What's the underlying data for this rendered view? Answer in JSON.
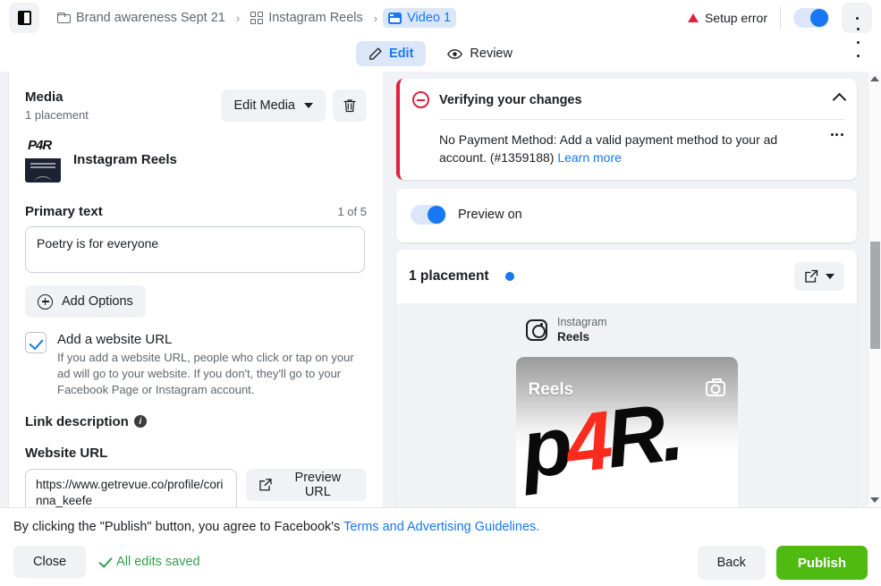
{
  "topbar": {
    "sidebar_toggle_icon": "panel-left-icon",
    "breadcrumb": [
      {
        "label": "Brand awareness Sept 21",
        "icon": "folder-icon",
        "active": false
      },
      {
        "label": "Instagram Reels",
        "icon": "grid-icon",
        "active": false
      },
      {
        "label": "Video 1",
        "icon": "video-card-icon",
        "active": true
      }
    ],
    "separator": "›",
    "setup_error_label": "Setup error",
    "warning_icon": "warning-triangle-icon",
    "toggle_on": true,
    "more_icon": "ellipsis-icon"
  },
  "tabs": [
    {
      "label": "Edit",
      "icon": "pencil-icon",
      "active": true
    },
    {
      "label": "Review",
      "icon": "eye-icon",
      "active": false
    }
  ],
  "left_panel": {
    "media": {
      "title": "Media",
      "subtitle": "1 placement",
      "edit_button": "Edit Media",
      "delete_icon": "trash-icon",
      "caret_icon": "chevron-down-icon",
      "item_name": "Instagram Reels",
      "thumbnail_logo": "P4R"
    },
    "primary_text": {
      "label": "Primary text",
      "counter": "1 of 5",
      "value": "Poetry is for everyone"
    },
    "add_options_button": "Add Options",
    "website_url_checkbox": {
      "checked": true,
      "label": "Add a website URL",
      "help": "If you add a website URL, people who click or tap on your ad will go to your website. If you don't, they'll go to your Facebook Page or Instagram account."
    },
    "link_description": {
      "label": "Link description",
      "info_icon": "info-icon"
    },
    "website_url": {
      "label": "Website URL",
      "value": "https://www.getrevue.co/profile/corinna_keefe",
      "preview_button": "Preview URL",
      "preview_icon": "external-link-icon"
    }
  },
  "right_panel": {
    "error_card": {
      "icon": "stop-circle-icon",
      "title": "Verifying your changes",
      "collapse_icon": "chevron-up-icon",
      "message": "No Payment Method: Add a valid payment method to your ad account. (#1359188)",
      "link_text": "Learn more",
      "more_icon": "ellipsis-icon",
      "accent_color": "#e41e3f"
    },
    "preview_toggle": {
      "label": "Preview on",
      "on": true
    },
    "placement": {
      "title": "1 placement",
      "status_dot_color": "#1877f2",
      "open_icon": "external-link-icon",
      "caret_icon": "chevron-down-icon",
      "platform_icon": "instagram-icon",
      "platform_name": "Instagram",
      "placement_name": "Reels",
      "preview_label": "Reels",
      "preview_camera_icon": "camera-icon",
      "preview_logo": "p4R."
    }
  },
  "bottom_bar": {
    "legal_prefix": "By clicking the \"Publish\" button, you agree to Facebook's ",
    "legal_link": "Terms and Advertising Guidelines.",
    "close_label": "Close",
    "saved_label": "All edits saved",
    "saved_icon": "check-icon",
    "saved_color": "#31a24c",
    "back_label": "Back",
    "publish_label": "Publish",
    "publish_color": "#4fbb10"
  }
}
